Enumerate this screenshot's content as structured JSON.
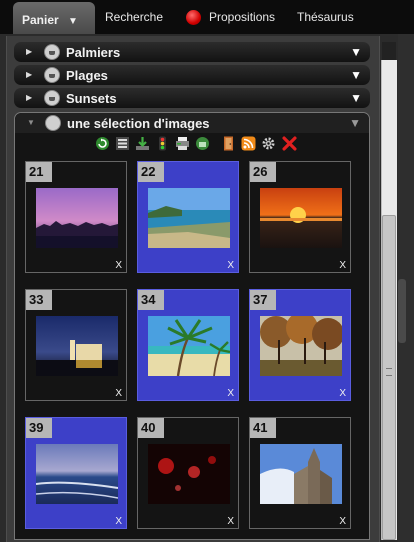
{
  "tabs": {
    "panier": "Panier",
    "panier_caret": "▼",
    "recherche": "Recherche",
    "propositions": "Propositions",
    "thesaurus": "Thésaurus"
  },
  "sections": [
    {
      "label": "Palmiers",
      "expanded": false
    },
    {
      "label": "Plages",
      "expanded": false
    },
    {
      "label": "Sunsets",
      "expanded": false
    },
    {
      "label": "une sélection d'images",
      "expanded": true
    }
  ],
  "toolbar_icons": [
    "refresh-icon",
    "list-icon",
    "download-icon",
    "traffic-light-icon",
    "print-icon",
    "basket-green-icon",
    "door-icon",
    "rss-icon",
    "gear-icon",
    "delete-icon"
  ],
  "thumbnails": [
    {
      "number": "21",
      "selected": false,
      "close": "X"
    },
    {
      "number": "22",
      "selected": true,
      "close": "X"
    },
    {
      "number": "26",
      "selected": false,
      "close": "X"
    },
    {
      "number": "33",
      "selected": false,
      "close": "X"
    },
    {
      "number": "34",
      "selected": true,
      "close": "X"
    },
    {
      "number": "37",
      "selected": true,
      "close": "X"
    },
    {
      "number": "39",
      "selected": true,
      "close": "X"
    },
    {
      "number": "40",
      "selected": false,
      "close": "X"
    },
    {
      "number": "41",
      "selected": false,
      "close": "X"
    }
  ],
  "colors": {
    "selection": "#3d40c8",
    "number_badge": "#b6b6b6",
    "panel_bg": "#3c3c3c"
  }
}
